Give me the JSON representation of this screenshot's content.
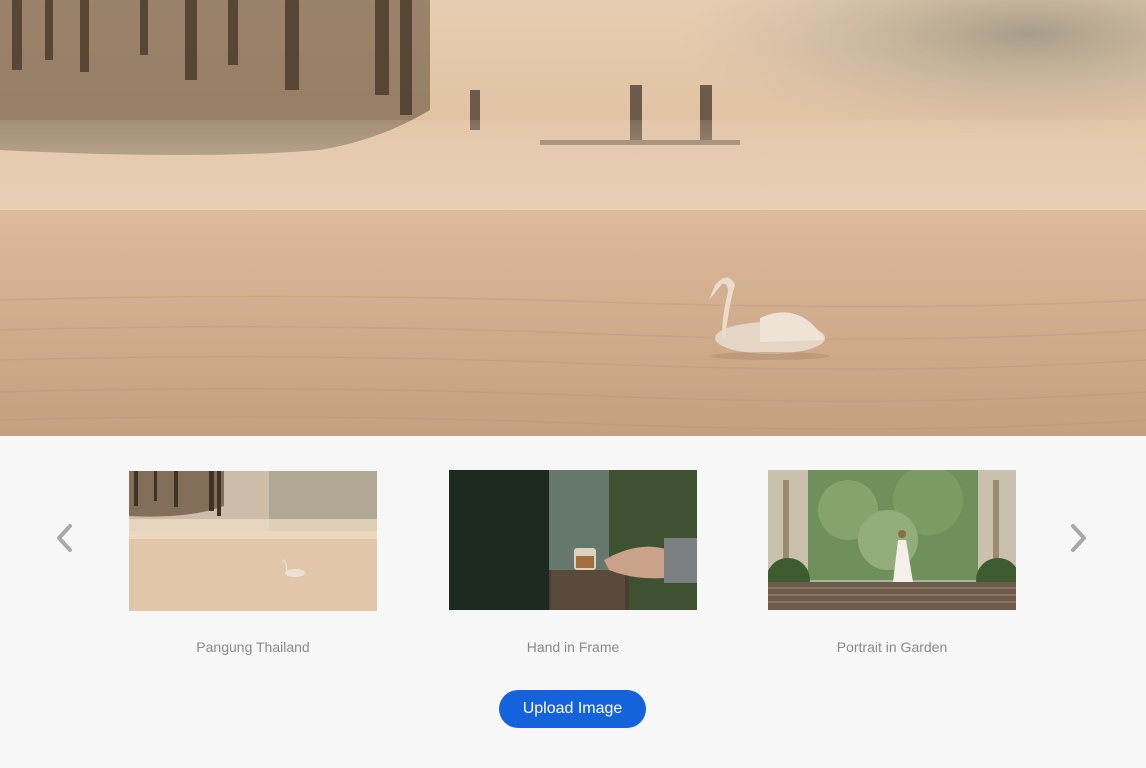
{
  "hero": {
    "icon": "swan-lake-photo"
  },
  "carousel": {
    "prev_icon": "chevron-left-icon",
    "next_icon": "chevron-right-icon",
    "arrow_color": "#a9a9a9",
    "items": [
      {
        "caption": "Pangung Thailand"
      },
      {
        "caption": "Hand in Frame"
      },
      {
        "caption": "Portrait in Garden"
      }
    ]
  },
  "actions": {
    "upload_label": "Upload Image",
    "accent_color": "#1463dc"
  }
}
